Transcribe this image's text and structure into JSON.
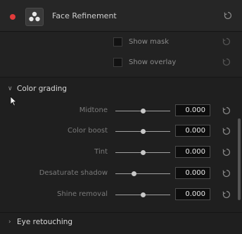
{
  "header": {
    "title": "Face Refinement",
    "icons": [
      "red-dot",
      "node-icon",
      "reset-icon"
    ]
  },
  "options": [
    {
      "label": "Show mask"
    },
    {
      "label": "Show overlay"
    }
  ],
  "sections": [
    {
      "label": "Color grading",
      "expanded": true
    },
    {
      "label": "Eye retouching",
      "expanded": false
    }
  ],
  "color_grading": {
    "params": [
      {
        "label": "Midtone",
        "value": "0.000"
      },
      {
        "label": "Color boost",
        "value": "0.000"
      },
      {
        "label": "Tint",
        "value": "0.000"
      },
      {
        "label": "Desaturate shadow",
        "value": "0.000"
      },
      {
        "label": "Shine removal",
        "value": "0.000"
      }
    ]
  },
  "colors": {
    "background": "#1f1f1f",
    "header_bg": "#262626",
    "close_dot": "#e23b3b",
    "value_box_bg": "#0d0d0d"
  }
}
